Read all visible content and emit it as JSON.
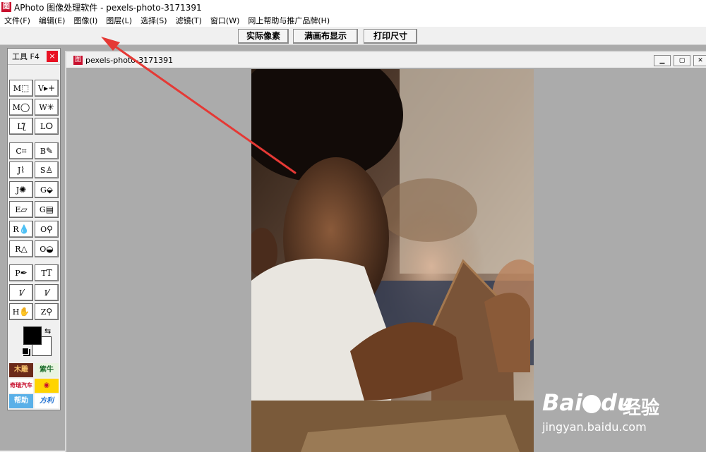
{
  "window": {
    "title": "APhoto 图像处理软件 - pexels-photo-3171391",
    "icon_glyph": "图"
  },
  "menu": [
    "文件(F)",
    "编辑(E)",
    "图像(I)",
    "图层(L)",
    "选择(S)",
    "滤镜(T)",
    "窗口(W)",
    "网上帮助与推广品牌(H)"
  ],
  "toolbar": {
    "actual_pixels": "实际像素",
    "fit_canvas": "满画布显示",
    "print_size": "打印尺寸"
  },
  "tool_panel": {
    "title": "工具 F4",
    "close": "×",
    "tools": [
      {
        "key": "M",
        "icon": "rect-select-icon",
        "glyph": "⬚"
      },
      {
        "key": "V",
        "icon": "move-icon",
        "glyph": "▸+"
      },
      {
        "key": "M",
        "icon": "ellipse-select-icon",
        "glyph": "◯"
      },
      {
        "key": "W",
        "icon": "magic-wand-icon",
        "glyph": "✳"
      },
      {
        "key": "L",
        "icon": "lasso-polygon-icon",
        "glyph": "ƪ"
      },
      {
        "key": "L",
        "icon": "lasso-icon",
        "glyph": "ⵔ"
      },
      {
        "key": "C",
        "icon": "crop-icon",
        "glyph": "⌗"
      },
      {
        "key": "B",
        "icon": "brush-icon",
        "glyph": "✎"
      },
      {
        "key": "J",
        "icon": "healing-icon",
        "glyph": "⌇"
      },
      {
        "key": "S",
        "icon": "stamp-icon",
        "glyph": "♙"
      },
      {
        "key": "J",
        "icon": "patch-icon",
        "glyph": "✺"
      },
      {
        "key": "G",
        "icon": "bucket-icon",
        "glyph": "⬙"
      },
      {
        "key": "E",
        "icon": "eraser-icon",
        "glyph": "▱"
      },
      {
        "key": "G",
        "icon": "gradient-icon",
        "glyph": "▤"
      },
      {
        "key": "R",
        "icon": "blur-icon",
        "glyph": "💧"
      },
      {
        "key": "O",
        "icon": "dodge-icon",
        "glyph": "⚲"
      },
      {
        "key": "R",
        "icon": "sharpen-icon",
        "glyph": "△"
      },
      {
        "key": "O",
        "icon": "sponge-icon",
        "glyph": "◒"
      },
      {
        "key": "P",
        "icon": "pen-icon",
        "glyph": "✒"
      },
      {
        "key": "T",
        "icon": "text-icon",
        "glyph": "T"
      },
      {
        "key": "I",
        "icon": "ruler-icon",
        "glyph": "⁄"
      },
      {
        "key": "I",
        "icon": "eyedropper-icon",
        "glyph": "⁄"
      },
      {
        "key": "H",
        "icon": "hand-icon",
        "glyph": "✋"
      },
      {
        "key": "Z",
        "icon": "zoom-icon",
        "glyph": "⚲"
      }
    ],
    "promos": [
      "木雕",
      "紫牛",
      "奇瑞汽车",
      "",
      "帮助",
      "方利"
    ]
  },
  "document": {
    "title": "pexels-photo-3171391",
    "icon_glyph": "图"
  },
  "watermark": {
    "brand": "Bai",
    "brand2": "du",
    "cn": "经验",
    "url": "jingyan.baidu.com"
  },
  "colors": {
    "workspace": "#ababab",
    "accent_red": "#e53935"
  }
}
